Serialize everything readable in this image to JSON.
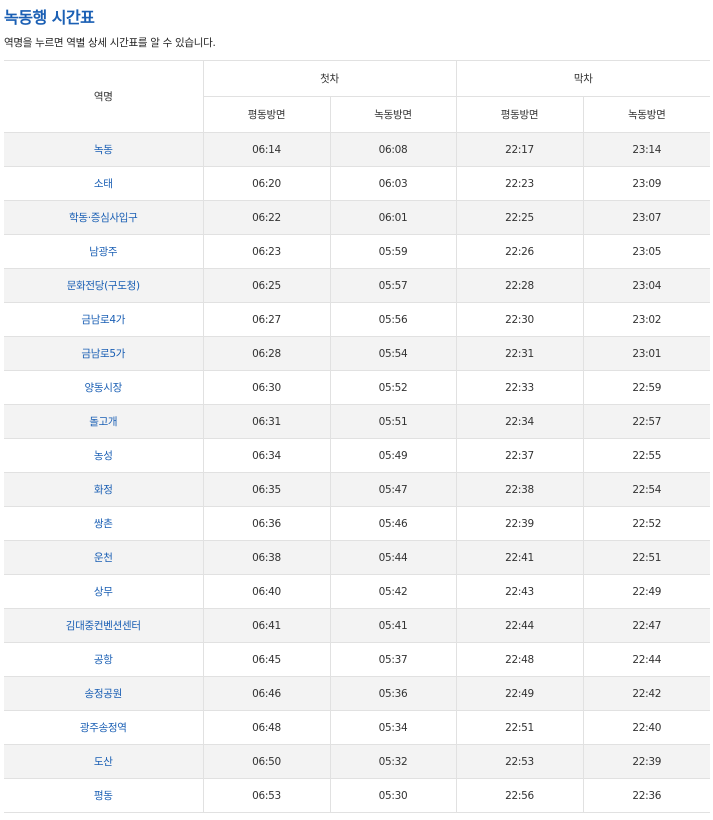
{
  "page": {
    "title": "녹동행 시간표",
    "description": "역명을 누르면 역별 상세 시간표를 알 수 있습니다."
  },
  "table": {
    "station_header": "역명",
    "first_train_header": "첫차",
    "last_train_header": "막차",
    "direction_headers": [
      "평동방면",
      "녹동방면",
      "평동방면",
      "녹동방면"
    ],
    "rows": [
      {
        "station": "녹동",
        "first_pyeongdong": "06:14",
        "first_nokdong": "06:08",
        "last_pyeongdong": "22:17",
        "last_nokdong": "23:14"
      },
      {
        "station": "소태",
        "first_pyeongdong": "06:20",
        "first_nokdong": "06:03",
        "last_pyeongdong": "22:23",
        "last_nokdong": "23:09"
      },
      {
        "station": "학동·증심사입구",
        "first_pyeongdong": "06:22",
        "first_nokdong": "06:01",
        "last_pyeongdong": "22:25",
        "last_nokdong": "23:07"
      },
      {
        "station": "남광주",
        "first_pyeongdong": "06:23",
        "first_nokdong": "05:59",
        "last_pyeongdong": "22:26",
        "last_nokdong": "23:05"
      },
      {
        "station": "문화전당(구도청)",
        "first_pyeongdong": "06:25",
        "first_nokdong": "05:57",
        "last_pyeongdong": "22:28",
        "last_nokdong": "23:04"
      },
      {
        "station": "금남로4가",
        "first_pyeongdong": "06:27",
        "first_nokdong": "05:56",
        "last_pyeongdong": "22:30",
        "last_nokdong": "23:02"
      },
      {
        "station": "금남로5가",
        "first_pyeongdong": "06:28",
        "first_nokdong": "05:54",
        "last_pyeongdong": "22:31",
        "last_nokdong": "23:01"
      },
      {
        "station": "양동시장",
        "first_pyeongdong": "06:30",
        "first_nokdong": "05:52",
        "last_pyeongdong": "22:33",
        "last_nokdong": "22:59"
      },
      {
        "station": "돌고개",
        "first_pyeongdong": "06:31",
        "first_nokdong": "05:51",
        "last_pyeongdong": "22:34",
        "last_nokdong": "22:57"
      },
      {
        "station": "농성",
        "first_pyeongdong": "06:34",
        "first_nokdong": "05:49",
        "last_pyeongdong": "22:37",
        "last_nokdong": "22:55"
      },
      {
        "station": "화정",
        "first_pyeongdong": "06:35",
        "first_nokdong": "05:47",
        "last_pyeongdong": "22:38",
        "last_nokdong": "22:54"
      },
      {
        "station": "쌍촌",
        "first_pyeongdong": "06:36",
        "first_nokdong": "05:46",
        "last_pyeongdong": "22:39",
        "last_nokdong": "22:52"
      },
      {
        "station": "운천",
        "first_pyeongdong": "06:38",
        "first_nokdong": "05:44",
        "last_pyeongdong": "22:41",
        "last_nokdong": "22:51"
      },
      {
        "station": "상무",
        "first_pyeongdong": "06:40",
        "first_nokdong": "05:42",
        "last_pyeongdong": "22:43",
        "last_nokdong": "22:49"
      },
      {
        "station": "김대중컨벤션센터",
        "first_pyeongdong": "06:41",
        "first_nokdong": "05:41",
        "last_pyeongdong": "22:44",
        "last_nokdong": "22:47"
      },
      {
        "station": "공항",
        "first_pyeongdong": "06:45",
        "first_nokdong": "05:37",
        "last_pyeongdong": "22:48",
        "last_nokdong": "22:44"
      },
      {
        "station": "송정공원",
        "first_pyeongdong": "06:46",
        "first_nokdong": "05:36",
        "last_pyeongdong": "22:49",
        "last_nokdong": "22:42"
      },
      {
        "station": "광주송정역",
        "first_pyeongdong": "06:48",
        "first_nokdong": "05:34",
        "last_pyeongdong": "22:51",
        "last_nokdong": "22:40"
      },
      {
        "station": "도산",
        "first_pyeongdong": "06:50",
        "first_nokdong": "05:32",
        "last_pyeongdong": "22:53",
        "last_nokdong": "22:39"
      },
      {
        "station": "평동",
        "first_pyeongdong": "06:53",
        "first_nokdong": "05:30",
        "last_pyeongdong": "22:56",
        "last_nokdong": "22:36"
      }
    ]
  },
  "colors": {
    "title": "#1a5fb4",
    "station_link": "#1a5fb4",
    "row_stripe": "#f3f3f3"
  }
}
